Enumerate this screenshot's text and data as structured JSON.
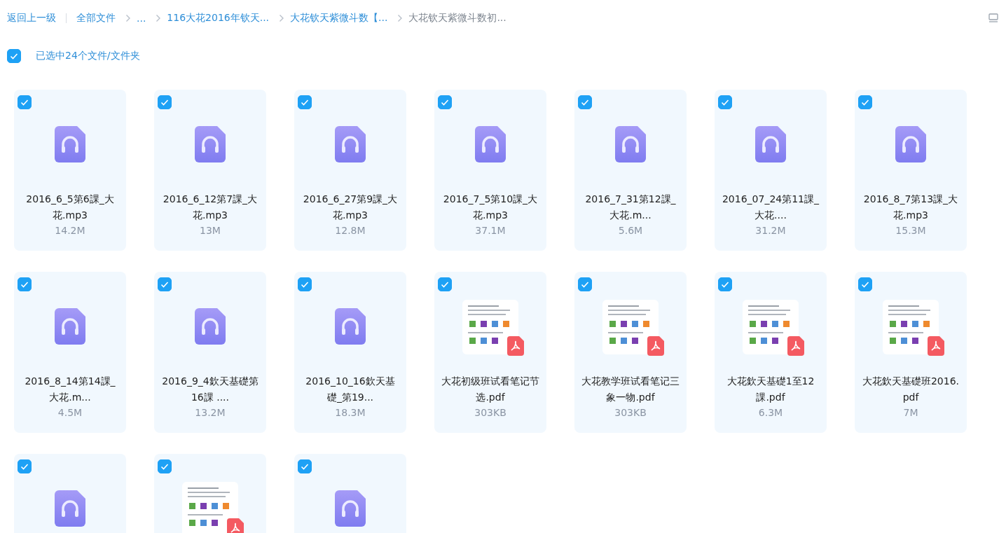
{
  "breadcrumb": {
    "back": "返回上一级",
    "items": [
      {
        "label": "全部文件",
        "current": false
      },
      {
        "label": "...",
        "current": false
      },
      {
        "label": "116大花2016年钦天...",
        "current": false
      },
      {
        "label": "大花钦天紫微斗数【...",
        "current": false
      },
      {
        "label": "大花钦天紫微斗数初...",
        "current": true
      }
    ]
  },
  "selection": {
    "checked": true,
    "label": "已选中24个文件/文件夹"
  },
  "files": [
    {
      "kind": "audio",
      "checked": true,
      "name": "2016_6_5第6課_大花.mp3",
      "size": "14.2M"
    },
    {
      "kind": "audio",
      "checked": true,
      "name": "2016_6_12第7課_大花.mp3",
      "size": "13M"
    },
    {
      "kind": "audio",
      "checked": true,
      "name": "2016_6_27第9課_大花.mp3",
      "size": "12.8M"
    },
    {
      "kind": "audio",
      "checked": true,
      "name": "2016_7_5第10課_大花.mp3",
      "size": "37.1M"
    },
    {
      "kind": "audio",
      "checked": true,
      "name": "2016_7_31第12課_大花.m...",
      "size": "5.6M"
    },
    {
      "kind": "audio",
      "checked": true,
      "name": "2016_07_24第11課_大花....",
      "size": "31.2M"
    },
    {
      "kind": "audio",
      "checked": true,
      "name": "2016_8_7第13課_大花.mp3",
      "size": "15.3M"
    },
    {
      "kind": "audio",
      "checked": true,
      "name": "2016_8_14第14課_大花.m...",
      "size": "4.5M"
    },
    {
      "kind": "audio",
      "checked": true,
      "name": "2016_9_4欽天基礎第16課 ....",
      "size": "13.2M"
    },
    {
      "kind": "audio",
      "checked": true,
      "name": "2016_10_16欽天基礎_第19...",
      "size": "18.3M"
    },
    {
      "kind": "pdf",
      "checked": true,
      "name": "大花初级班试看笔记节选.pdf",
      "size": "303KB"
    },
    {
      "kind": "pdf",
      "checked": true,
      "name": "大花教学班试看笔记三象一物.pdf",
      "size": "303KB"
    },
    {
      "kind": "pdf",
      "checked": true,
      "name": "大花欽天基礎1至12課.pdf",
      "size": "6.3M"
    },
    {
      "kind": "pdf",
      "checked": true,
      "name": "大花欽天基礎班2016.pdf",
      "size": "7M"
    },
    {
      "kind": "audio",
      "checked": true
    },
    {
      "kind": "pdf",
      "checked": true
    },
    {
      "kind": "audio",
      "checked": true
    }
  ]
}
